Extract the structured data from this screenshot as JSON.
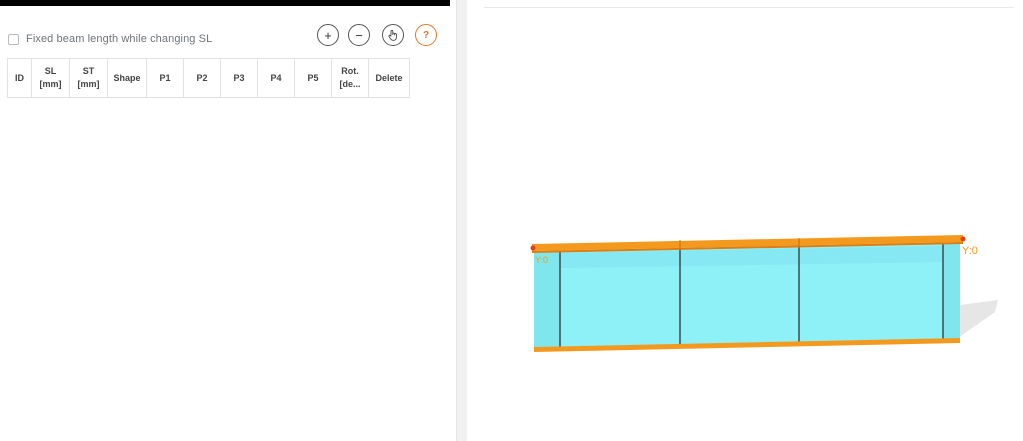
{
  "left_panel": {
    "fixed_beam_checkbox": {
      "label": "Fixed beam length while changing SL",
      "checked": false
    },
    "toolbar": {
      "add_symbol": "+",
      "remove_symbol": "−",
      "pick_icon": "pointer-hand-icon",
      "help_symbol": "?"
    },
    "table": {
      "columns": [
        {
          "line1": "ID",
          "line2": ""
        },
        {
          "line1": "SL",
          "line2": "[mm]"
        },
        {
          "line1": "ST",
          "line2": "[mm]"
        },
        {
          "line1": "Shape",
          "line2": ""
        },
        {
          "line1": "P1",
          "line2": ""
        },
        {
          "line1": "P2",
          "line2": ""
        },
        {
          "line1": "P3",
          "line2": ""
        },
        {
          "line1": "P4",
          "line2": ""
        },
        {
          "line1": "P5",
          "line2": ""
        },
        {
          "line1": "Rot.",
          "line2": "[de..."
        },
        {
          "line1": "Delete",
          "line2": ""
        }
      ],
      "rows": []
    }
  },
  "viewer": {
    "left_support_label": "Y:0",
    "right_support_label": "Y:0",
    "colors": {
      "flange": "#f39a1e",
      "flange_dark": "#e07d10",
      "web": "#8ef1f7",
      "web_dark": "#6fd8e4",
      "stiffener": "#3d4a50",
      "shadow": "#e6e6e6",
      "label": "#f39a1e"
    }
  }
}
